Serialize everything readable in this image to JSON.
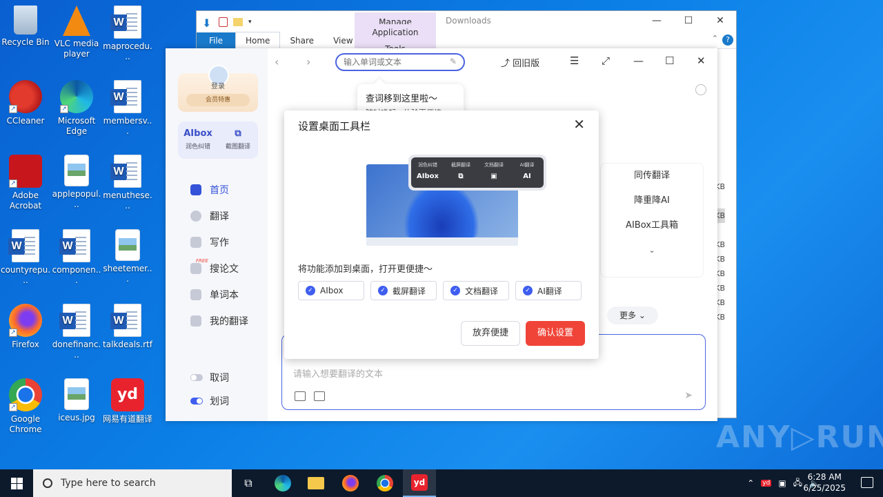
{
  "desktop": {
    "icons": [
      {
        "label": "Recycle Bin"
      },
      {
        "label": "VLC media player"
      },
      {
        "label": "maprocedu..."
      },
      {
        "label": "CCleaner"
      },
      {
        "label": "Microsoft Edge"
      },
      {
        "label": "membersv..."
      },
      {
        "label": "Adobe Acrobat"
      },
      {
        "label": "applepopul..."
      },
      {
        "label": "menuthese..."
      },
      {
        "label": "countyrepu..."
      },
      {
        "label": "componen..."
      },
      {
        "label": "sheetemer..."
      },
      {
        "label": "Firefox"
      },
      {
        "label": "donefinanc..."
      },
      {
        "label": "talkdeals.rtf"
      },
      {
        "label": "Google Chrome"
      },
      {
        "label": "iceus.jpg"
      },
      {
        "label": "网易有道翻译"
      }
    ]
  },
  "explorer": {
    "title": "Downloads",
    "manage_tab": "Manage",
    "ribbon": {
      "file": "File",
      "home": "Home",
      "share": "Share",
      "view": "View",
      "app_tools": "Application Tools"
    },
    "sizes": [
      "KB",
      "KB",
      "KB",
      "KB",
      "KB",
      "KB",
      "KB",
      "KB",
      "KB",
      "KB"
    ]
  },
  "youdao": {
    "sidebar": {
      "login": "登录",
      "vip": "会员特惠",
      "tools": [
        {
          "icon_text": "AIbox",
          "label": "润色纠错"
        },
        {
          "icon_text": "⧉",
          "label": "截图翻译"
        }
      ],
      "nav": [
        "首页",
        "翻译",
        "写作",
        "搜论文",
        "单词本",
        "我的翻译"
      ],
      "free_badge": "FREE",
      "toggles": [
        "取词",
        "划词"
      ]
    },
    "topbar": {
      "search_placeholder": "输入单词或文本",
      "back_old": "回旧版"
    },
    "tip": {
      "line1": "查词移到这里啦～",
      "line2": "随时唤起，体验更便捷"
    },
    "right_panel": [
      "同传翻译",
      "降重降AI",
      "AIBox工具箱"
    ],
    "more_button": "更多",
    "input_placeholder": "请输入想要翻译的文本",
    "dialog": {
      "title": "设置桌面工具栏",
      "preview_tools": [
        {
          "label": "润色纠错",
          "icon": "AIbox"
        },
        {
          "label": "截屏翻译",
          "icon": "⧉"
        },
        {
          "label": "文档翻译",
          "icon": "▣"
        },
        {
          "label": "AI翻译",
          "icon": "AI"
        }
      ],
      "description": "将功能添加到桌面，打开更便捷～",
      "options": [
        "AIbox",
        "截屏翻译",
        "文档翻译",
        "AI翻译"
      ],
      "cancel": "放弃便捷",
      "confirm": "确认设置"
    }
  },
  "watermark": "ANY▷RUN",
  "taskbar": {
    "search_placeholder": "Type here to search",
    "time": "6:28 AM",
    "date": "6/25/2025"
  }
}
